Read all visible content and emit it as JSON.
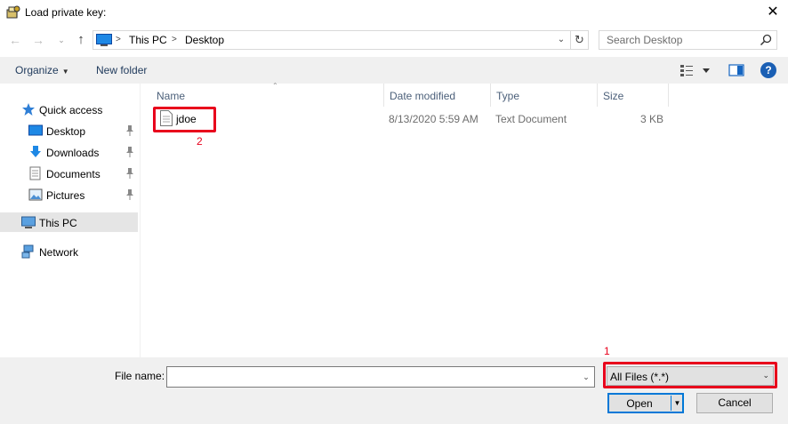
{
  "window": {
    "title": "Load private key:",
    "close_glyph": "✕"
  },
  "navigation": {
    "back_glyph": "←",
    "forward_glyph": "→",
    "recent_glyph": "⌄",
    "up_glyph": "↑",
    "breadcrumb": [
      "This PC",
      "Desktop"
    ],
    "breadcrumb_sep": ">",
    "dropdown_glyph": "⌄",
    "refresh_glyph": "↻"
  },
  "search": {
    "placeholder": "Search Desktop"
  },
  "toolbar": {
    "organize_label": "Organize",
    "caret_glyph": "▼",
    "new_folder_label": "New folder",
    "help_glyph": "?"
  },
  "sidebar": {
    "items": [
      {
        "label": "Quick access",
        "icon": "star-icon"
      },
      {
        "label": "Desktop",
        "icon": "desktop-folder-icon",
        "pinned": true
      },
      {
        "label": "Downloads",
        "icon": "download-arrow-icon",
        "pinned": true
      },
      {
        "label": "Documents",
        "icon": "documents-icon",
        "pinned": true
      },
      {
        "label": "Pictures",
        "icon": "pictures-icon",
        "pinned": true
      },
      {
        "label": "This PC",
        "icon": "computer-icon",
        "selected": true
      },
      {
        "label": "Network",
        "icon": "network-icon"
      }
    ]
  },
  "file_list": {
    "columns": [
      "Name",
      "Date modified",
      "Type",
      "Size"
    ],
    "sort_glyph": "⌃",
    "rows": [
      {
        "name": "jdoe",
        "date_modified": "8/13/2020 5:59 AM",
        "type": "Text Document",
        "size": "3 KB"
      }
    ]
  },
  "annotations": [
    {
      "number": "1",
      "target": "file-type-select"
    },
    {
      "number": "2",
      "target": "file-jdoe"
    }
  ],
  "footer": {
    "file_name_label": "File name:",
    "file_name_value": "",
    "dropdown_glyph": "⌄",
    "file_type_value": "All Files (*.*)",
    "open_label": "Open",
    "open_split_glyph": "▼",
    "cancel_label": "Cancel"
  },
  "colors": {
    "highlight": "#e8001c",
    "accent": "#0078d7",
    "selected_row": "#e5e5e5"
  }
}
